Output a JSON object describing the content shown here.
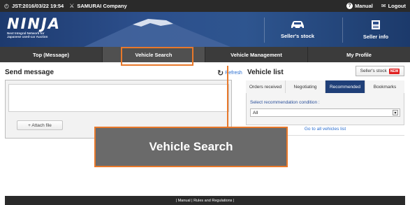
{
  "topbar": {
    "datetime": "JST:2016/03/22 19:54",
    "company": "SAMURAI Company",
    "manual_label": "Manual",
    "logout_label": "Logout"
  },
  "banner": {
    "logo_word": "NINJA",
    "logo_tagline_1": "Next Integral Network for",
    "logo_tagline_2": "Japanese used-car Auction",
    "sellers_stock_label": "Seller's stock",
    "seller_info_label": "Seller info"
  },
  "nav": {
    "tabs": [
      {
        "label": "Top (Message)"
      },
      {
        "label": "Vehicle Search"
      },
      {
        "label": "Vehicle Management"
      },
      {
        "label": "My Profile"
      }
    ]
  },
  "send_message": {
    "title": "Send message",
    "refresh_label": "Refresh",
    "attach_label": "+ Attach file"
  },
  "vehicle_list": {
    "title": "Vehicle list",
    "stock_button": "Seller's stock",
    "new_badge": "NEW",
    "tabs": [
      {
        "label": "Orders received"
      },
      {
        "label": "Negotiating"
      },
      {
        "label": "Recommended"
      },
      {
        "label": "Bookmarks"
      }
    ],
    "select_label": "Select recommendation condition :",
    "select_value": "All",
    "goto_link": "Go to all vehicles list"
  },
  "callout": {
    "text": "Vehicle Search"
  },
  "footer": {
    "text": "| Manual | Rules and Regulations |"
  },
  "colors": {
    "highlight": "#e8782a",
    "banner": "#2c4f8c",
    "active_tab": "#1f3f78"
  }
}
